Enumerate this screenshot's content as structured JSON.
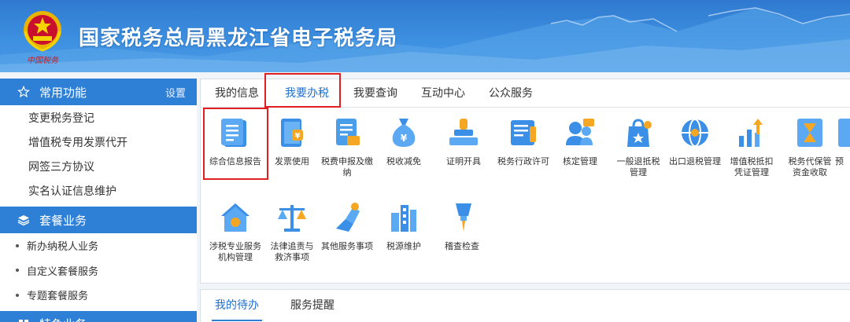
{
  "header": {
    "title": "国家税务总局黑龙江省电子税务局",
    "emblem_caption": "中国税务"
  },
  "sidebar": {
    "common": {
      "title": "常用功能",
      "settings_label": "设置",
      "icon": "star-outline-icon",
      "items": [
        "变更税务登记",
        "增值税专用发票代开",
        "网签三方协议",
        "实名认证信息维护"
      ]
    },
    "package": {
      "title": "套餐业务",
      "icon": "layers-icon",
      "items": [
        "新办纳税人业务",
        "自定义套餐服务",
        "专题套餐服务"
      ]
    },
    "next_section": {
      "title": "特色业务",
      "icon": "grid-icon"
    }
  },
  "main": {
    "tabs": [
      "我的信息",
      "我要办税",
      "我要查询",
      "互动中心",
      "公众服务"
    ],
    "active_tab": "我要办税",
    "row1": [
      {
        "label": "综合信息报告",
        "icon": "report-doc-icon"
      },
      {
        "label": "发票使用",
        "icon": "invoice-book-icon"
      },
      {
        "label": "税费申报及缴纳",
        "icon": "tax-declare-icon"
      },
      {
        "label": "税收减免",
        "icon": "money-bag-icon"
      },
      {
        "label": "证明开具",
        "icon": "stamp-icon"
      },
      {
        "label": "税务行政许可",
        "icon": "license-icon"
      },
      {
        "label": "核定管理",
        "icon": "people-check-icon"
      },
      {
        "label": "一般退抵税\n管理",
        "icon": "refund-bag-icon"
      },
      {
        "label": "出口退税管理",
        "icon": "globe-icon"
      },
      {
        "label": "增值税抵扣\n凭证管理",
        "icon": "bar-chart-up-icon"
      },
      {
        "label": "税务代保管\n资金收取",
        "icon": "fund-hourglass-icon"
      },
      {
        "label": "预",
        "icon": "partial-icon"
      }
    ],
    "row2": [
      {
        "label": "涉税专业服务\n机构管理",
        "icon": "house-tool-icon"
      },
      {
        "label": "法律追责与\n救济事项",
        "icon": "scale-icon"
      },
      {
        "label": "其他服务事项",
        "icon": "service-hand-icon"
      },
      {
        "label": "税源维护",
        "icon": "building-icon"
      },
      {
        "label": "稽查检查",
        "icon": "pin-check-icon"
      }
    ]
  },
  "bottom": {
    "tabs": [
      "我的待办",
      "服务提醒"
    ],
    "active_tab": "我的待办"
  },
  "colors": {
    "brand_blue": "#2e7fd6",
    "highlight_red": "#e02020",
    "icon_orange": "#f5a623"
  }
}
